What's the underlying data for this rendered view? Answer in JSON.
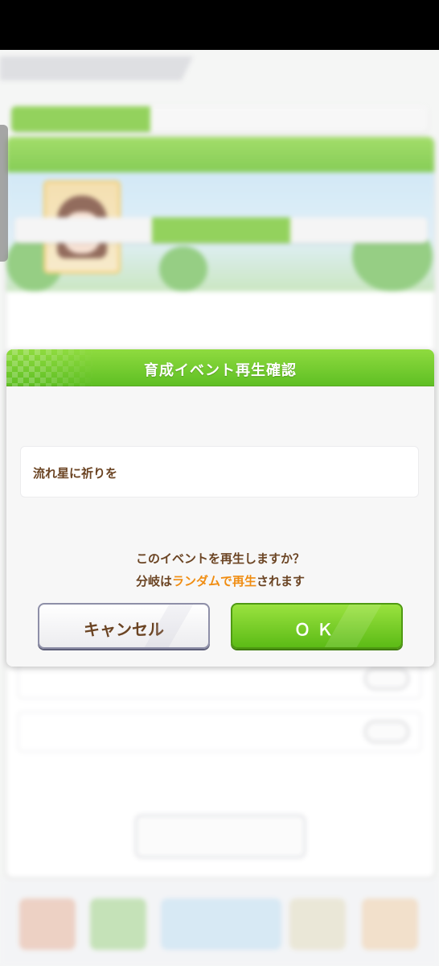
{
  "dialog": {
    "title": "育成イベント再生確認",
    "event_name": "流れ星に祈りを",
    "question": "このイベントを再生しますか？",
    "note_prefix": "分岐は",
    "note_highlight": "ランダムで再生",
    "note_suffix": "されます",
    "cancel_label": "キャンセル",
    "ok_label": "ＯＫ"
  },
  "colors": {
    "header_green": "#6cc232",
    "ok_green": "#5cbb16",
    "text_brown": "#6b4423",
    "highlight_orange": "#f08d12"
  }
}
